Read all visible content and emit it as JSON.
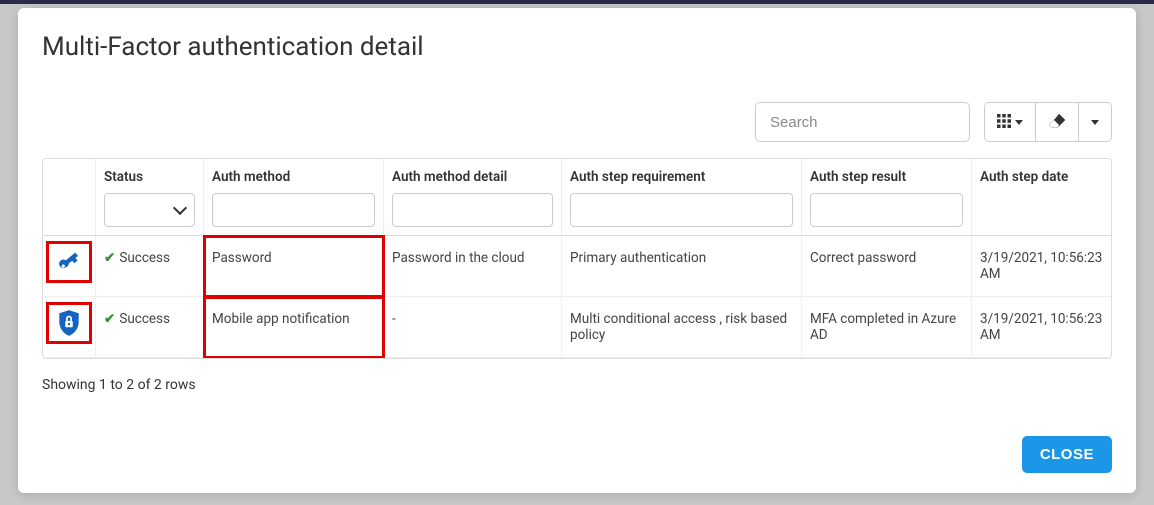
{
  "modal": {
    "title": "Multi-Factor authentication detail",
    "search_placeholder": "Search",
    "close_label": "CLOSE",
    "footer_text": "Showing 1 to 2 of 2 rows"
  },
  "columns": {
    "status": "Status",
    "method": "Auth method",
    "detail": "Auth method detail",
    "requirement": "Auth step requirement",
    "result": "Auth step result",
    "date": "Auth step date"
  },
  "rows": [
    {
      "icon": "key",
      "status": "Success",
      "method": "Password",
      "detail": "Password in the cloud",
      "requirement": "Primary authentication",
      "result": "Correct password",
      "date": "3/19/2021, 10:56:23 AM"
    },
    {
      "icon": "shield-lock",
      "status": "Success",
      "method": "Mobile app notification",
      "detail": "-",
      "requirement": "Multi conditional access , risk based policy",
      "result": "MFA completed in Azure AD",
      "date": "3/19/2021, 10:56:23 AM"
    }
  ]
}
